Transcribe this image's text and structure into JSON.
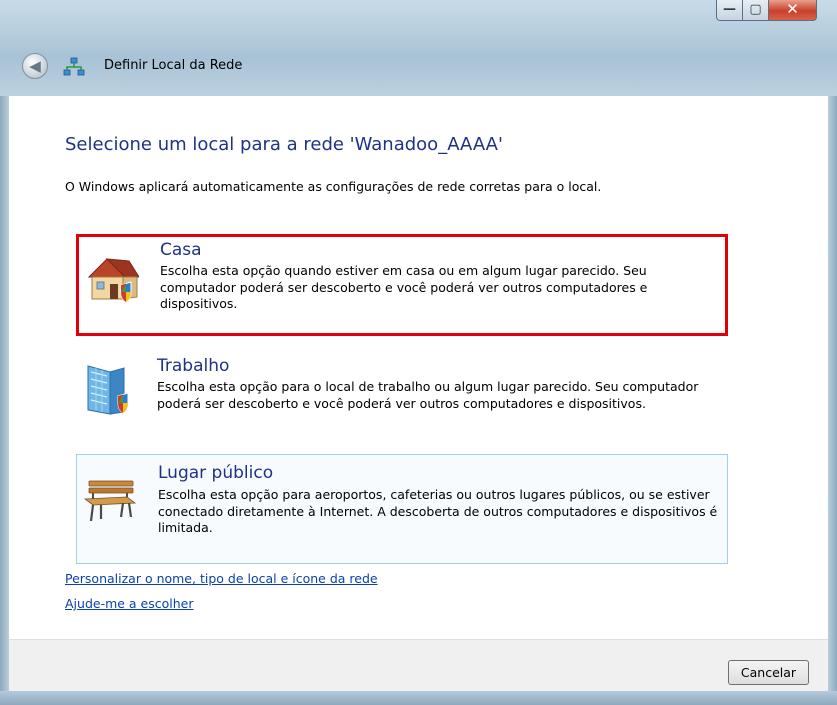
{
  "window": {
    "title": "Definir Local da Rede",
    "controls": {
      "minimize": "—",
      "maximize": "▢",
      "close": "✕"
    }
  },
  "main": {
    "heading": "Selecione um local para a rede 'Wanadoo_AAAA'",
    "description": "O Windows aplicará automaticamente as configurações de rede corretas para o local."
  },
  "options": [
    {
      "title": "Casa",
      "text": "Escolha esta opção quando estiver em casa ou em algum lugar parecido. Seu computador poderá ser descoberto e você poderá ver outros computadores e dispositivos.",
      "icon": "house-icon",
      "highlighted": true,
      "highlight_color": "#e0000a"
    },
    {
      "title": "Trabalho",
      "text": "Escolha esta opção para o local de trabalho ou algum lugar parecido. Seu computador poderá ser descoberto e você poderá ver outros computadores e dispositivos.",
      "icon": "office-building-icon"
    },
    {
      "title": "Lugar público",
      "text": "Escolha esta opção para aeroportos, cafeterias ou outros lugares públicos, ou se estiver conectado diretamente à Internet. A descoberta de outros computadores e dispositivos é limitada.",
      "icon": "park-bench-icon"
    }
  ],
  "links": {
    "customize": "Personalizar o nome, tipo de local e ícone da rede",
    "help": "Ajude-me a escolher"
  },
  "footer": {
    "cancel_label": "Cancelar"
  },
  "colors": {
    "heading": "#1e3287",
    "link": "#0b40b0",
    "highlight": "#e0000a"
  }
}
